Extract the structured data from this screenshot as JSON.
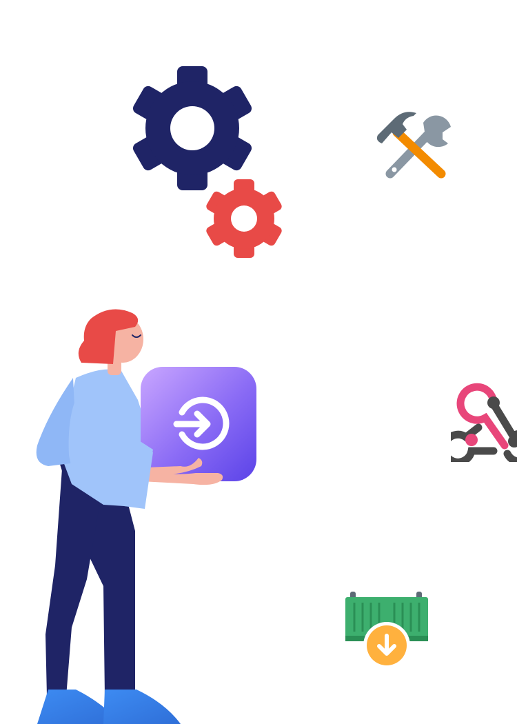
{
  "illustration": {
    "icons": [
      {
        "name": "large-gear-icon",
        "color": "#1F2466"
      },
      {
        "name": "small-gear-icon",
        "color": "#E84A47"
      },
      {
        "name": "hammer-wrench-icon",
        "colors": [
          "#5D6B76",
          "#8A97A3",
          "#F38B00"
        ]
      },
      {
        "name": "webhook-icon",
        "colors": [
          "#E8467A",
          "#4A4A4A"
        ]
      },
      {
        "name": "container-download-icon",
        "colors": [
          "#3DAF6E",
          "#FFB13E"
        ]
      },
      {
        "name": "sign-in-icon",
        "colors": [
          "#C9A6FF",
          "#6B4BEA",
          "#FFFFFF"
        ]
      }
    ],
    "person": {
      "hair_color": "#E84A47",
      "shirt_color": "#A0C4FA",
      "pants_color": "#1F2466",
      "shoe_color": "#3D8BF2",
      "skin_color": "#F6B3A3"
    }
  }
}
